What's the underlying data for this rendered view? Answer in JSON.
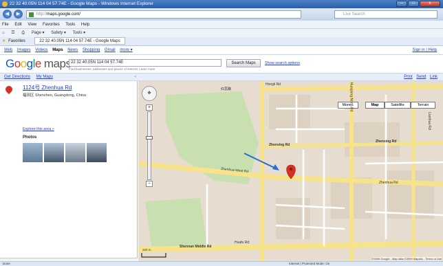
{
  "window": {
    "title": "22 32 40.05N 114 04 57.74E - Google Maps - Windows Internet Explorer",
    "min_label": "–",
    "max_label": "□",
    "close_label": "x"
  },
  "addressbar": {
    "url_prefix": "http://",
    "url_host": "maps.google.com/",
    "search_placeholder": "Live Search",
    "back_icon": "back-arrow-icon",
    "forward_icon": "forward-arrow-icon"
  },
  "menu": [
    "File",
    "Edit",
    "View",
    "Favorites",
    "Tools",
    "Help"
  ],
  "commandbar": [
    "Page ▾",
    "Safety ▾",
    "Tools ▾"
  ],
  "favorites": {
    "label": "Favorites",
    "tab": "22 32 40.05N 114 04 57.74E - Google Maps"
  },
  "google_nav": {
    "links": [
      "Web",
      "Images",
      "Videos"
    ],
    "active": "Maps",
    "links2": [
      "News",
      "Shopping",
      "Gmail",
      "more ▾"
    ],
    "signin": "Sign in | Help"
  },
  "search": {
    "logo_g": "G",
    "logo_o1": "o",
    "logo_o2": "o",
    "logo_g2": "g",
    "logo_l": "l",
    "logo_e": "e",
    "logo_maps": "maps",
    "query": "22 32 40.05N 114 04 57.74E",
    "hint": "Find businesses, addresses and places of interest. Learn more",
    "button": "Search Maps",
    "options": "Show search options"
  },
  "subbar": {
    "directions": "Get Directions",
    "mymaps": "My Maps",
    "collapse": "«",
    "print": "Print",
    "send": "Send",
    "link": "Link"
  },
  "result": {
    "title": "1124号 Zhenhua Rd",
    "address": "福田区 Shenzhen, Guangdong, China",
    "explore": "Explore this area »",
    "photos": "Photos"
  },
  "map": {
    "buttons": {
      "more": "More...",
      "map": "Map",
      "satellite": "Satellite",
      "terrain": "Terrain"
    },
    "labels": {
      "hongli": "Hongli Rd",
      "zhenxing": "Zhenxing Rd",
      "zhenhua_west": "Zhenhua West Rd",
      "zhenhua": "Zhenhua Rd",
      "shennan": "Shennan Middle Rd",
      "huafu": "Huafu Rd",
      "lianhua": "Lianhua Rd",
      "huaqiang": "Huaqiang North Rd",
      "mid": "红荔路"
    },
    "scale": "200 m",
    "copyright": "©2009 Google - Map data ©2009 Mapabc - Terms of Use"
  },
  "status": {
    "left": "Done",
    "zone": "Internet | Protected Mode: On"
  },
  "colors": {
    "road_major": "#f7e38a",
    "road_minor": "#ffffff",
    "park": "#c8dfb0",
    "block": "#e6ddd0",
    "arrow": "#1f6fd6",
    "marker": "#d93025"
  }
}
